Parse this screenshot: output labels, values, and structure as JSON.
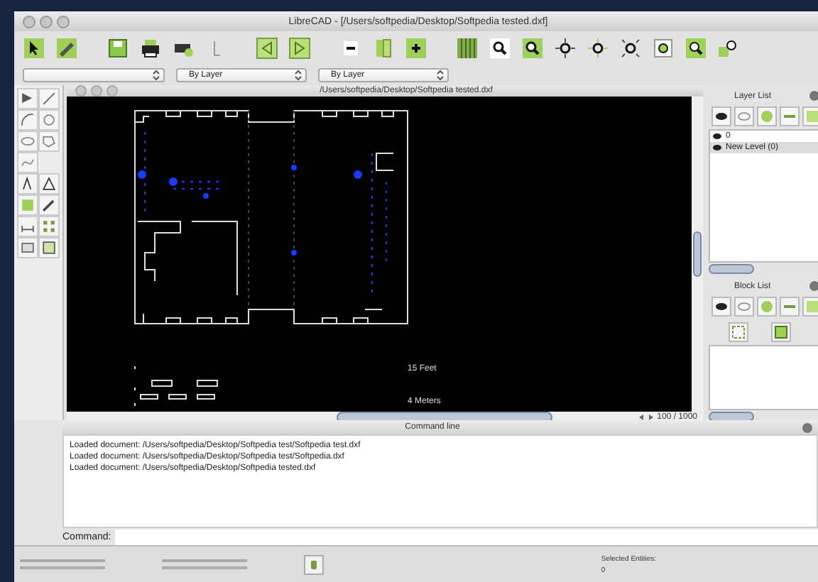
{
  "window": {
    "title": "LibreCAD - [/Users/softpedia/Desktop/Softpedia tested.dxf]"
  },
  "pen_bar": {
    "dropdowns": [
      {
        "value": "By Layer"
      },
      {
        "value": "By Layer"
      }
    ]
  },
  "document": {
    "title": "/Users/softpedia/Desktop/Softpedia tested.dxf",
    "labels": [
      "15 Feet",
      "4 Meters"
    ],
    "grid_readout": "100 / 1000"
  },
  "layer_list": {
    "title": "Layer List",
    "layers": [
      {
        "name": "0",
        "selected": false
      },
      {
        "name": "New Level (0)",
        "selected": true
      }
    ]
  },
  "block_list": {
    "title": "Block List"
  },
  "command_line": {
    "title": "Command line",
    "log": [
      "Loaded document: /Users/softpedia/Desktop/Softpedia test/Softpedia test.dxf",
      "Loaded document: /Users/softpedia/Desktop/Softpedia test/Softpedia.dxf",
      "Loaded document: /Users/softpedia/Desktop/Softpedia tested.dxf"
    ],
    "prompt": "Command:"
  },
  "status_bar": {
    "selected_label": "Selected Entities:",
    "selected_value": "0"
  }
}
